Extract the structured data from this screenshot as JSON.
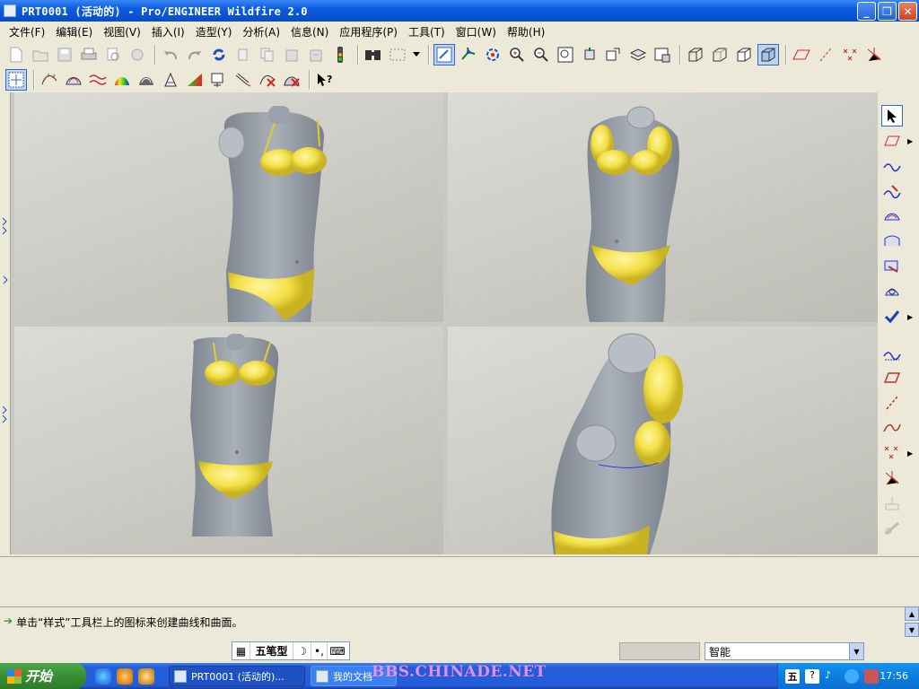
{
  "window": {
    "title": "PRT0001 (活动的) - Pro/ENGINEER Wildfire 2.0",
    "minimize_icon": "minimize-icon",
    "maximize_icon": "restore-icon",
    "close_icon": "close-icon"
  },
  "menu": [
    "文件(F)",
    "编辑(E)",
    "视图(V)",
    "插入(I)",
    "造型(Y)",
    "分析(A)",
    "信息(N)",
    "应用程序(P)",
    "工具(T)",
    "窗口(W)",
    "帮助(H)"
  ],
  "toolbar1": [
    "new-icon",
    "open-icon",
    "save-icon",
    "print-icon",
    "preview-icon",
    "email-icon",
    "undo-icon",
    "redo-icon",
    "regenerate-icon",
    "cut-icon",
    "copy-icon",
    "paste-icon",
    "paste-special-icon",
    "traffic-light-icon",
    "find-icon",
    "select-box-icon",
    "dropdown-icon",
    "model-tree-icon",
    "datum-axis-icon",
    "spin-center-icon",
    "zoom-in-icon",
    "zoom-out-icon",
    "refit-icon",
    "orient-icon",
    "saved-views-icon",
    "layers-icon",
    "view-manager-icon",
    "wireframe-icon",
    "hidden-line-icon",
    "no-hidden-icon",
    "shading-icon",
    "datum-plane-icon",
    "axis-display-icon",
    "point-display-icon",
    "csys-display-icon"
  ],
  "toolbar2": [
    "active-plane-icon",
    "curve-analysis-icon",
    "surface-analysis-icon",
    "curvature-icon",
    "reflection-icon",
    "highlight-icon",
    "draft-icon",
    "slope-icon",
    "section-icon",
    "offset-icon",
    "delete-analysis-icon",
    "delete-all-icon",
    "context-help-icon"
  ],
  "right_toolbar": [
    "select-arrow-icon",
    "plane-icon",
    "curve-icon",
    "curve-on-surface-icon",
    "surface-icon",
    "boundary-surface-icon",
    "trim-icon",
    "edit-curve-icon",
    "done-check-icon",
    "curve-divider-icon",
    "sketch-plane-icon",
    "line-icon",
    "free-curve-icon",
    "points-icon",
    "intersect-icon",
    "drop-curve-icon",
    "connect-icon"
  ],
  "viewports": [
    "front-view",
    "top-iso-view",
    "front-view-2",
    "isometric-view"
  ],
  "message": "单击“样式”工具栏上的图标来创建曲线和曲面。",
  "status": {
    "ime": [
      "五笔型"
    ],
    "smart_filter": "智能"
  },
  "taskbar": {
    "start": "开始",
    "tasks": [
      "PRT0001 (活动的)...",
      "我的文档"
    ],
    "watermark": "BBS.CHINADE.NET",
    "clock": "17:56"
  },
  "colors": {
    "title_blue": "#0a52cf",
    "body_gray": "#8a9099",
    "bikini_yellow": "#f3e14a",
    "start_green": "#3a8f35"
  }
}
